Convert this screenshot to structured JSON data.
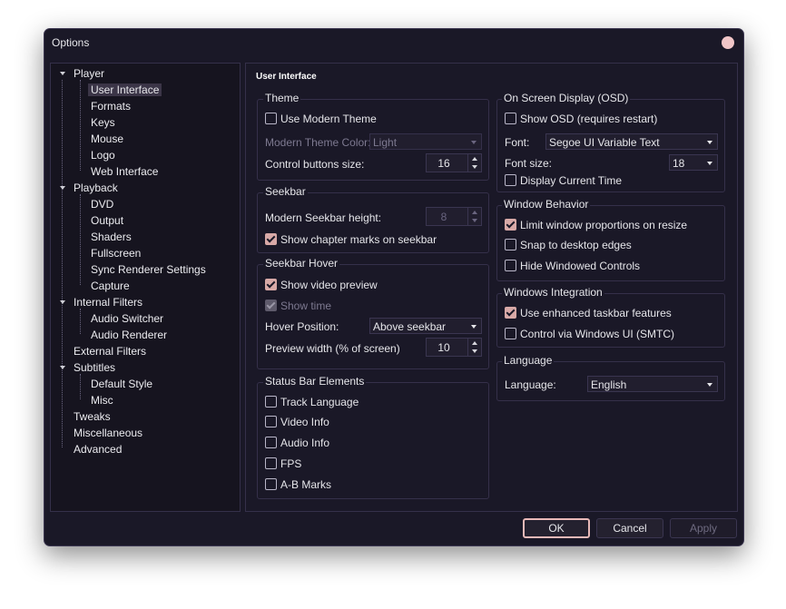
{
  "window": {
    "title": "Options"
  },
  "tree": {
    "items": [
      {
        "label": "Player",
        "level": 0,
        "expanded": true
      },
      {
        "label": "User Interface",
        "level": 1,
        "selected": true
      },
      {
        "label": "Formats",
        "level": 1
      },
      {
        "label": "Keys",
        "level": 1
      },
      {
        "label": "Mouse",
        "level": 1
      },
      {
        "label": "Logo",
        "level": 1
      },
      {
        "label": "Web Interface",
        "level": 1
      },
      {
        "label": "Playback",
        "level": 0,
        "expanded": true
      },
      {
        "label": "DVD",
        "level": 1
      },
      {
        "label": "Output",
        "level": 1
      },
      {
        "label": "Shaders",
        "level": 1
      },
      {
        "label": "Fullscreen",
        "level": 1
      },
      {
        "label": "Sync Renderer Settings",
        "level": 1
      },
      {
        "label": "Capture",
        "level": 1
      },
      {
        "label": "Internal Filters",
        "level": 0,
        "expanded": true
      },
      {
        "label": "Audio Switcher",
        "level": 1
      },
      {
        "label": "Audio Renderer",
        "level": 1
      },
      {
        "label": "External Filters",
        "level": 0
      },
      {
        "label": "Subtitles",
        "level": 0,
        "expanded": true
      },
      {
        "label": "Default Style",
        "level": 1
      },
      {
        "label": "Misc",
        "level": 1
      },
      {
        "label": "Tweaks",
        "level": 0
      },
      {
        "label": "Miscellaneous",
        "level": 0
      },
      {
        "label": "Advanced",
        "level": 0
      }
    ]
  },
  "page": {
    "title": "User Interface",
    "theme": {
      "title": "Theme",
      "use_modern_theme": "Use Modern Theme",
      "color_label": "Modern Theme Color:",
      "color_value": "Light",
      "buttons_size_label": "Control buttons size:",
      "buttons_size_value": "16"
    },
    "seekbar": {
      "title": "Seekbar",
      "height_label": "Modern Seekbar height:",
      "height_value": "8",
      "chapter_marks": "Show chapter marks on seekbar"
    },
    "seekbar_hover": {
      "title": "Seekbar Hover",
      "video_preview": "Show video preview",
      "show_time": "Show time",
      "position_label": "Hover Position:",
      "position_value": "Above seekbar",
      "preview_width_label": "Preview width (% of screen)",
      "preview_width_value": "10"
    },
    "status_bar": {
      "title": "Status Bar Elements",
      "items": [
        "Track Language",
        "Video Info",
        "Audio Info",
        "FPS",
        "A-B Marks"
      ]
    },
    "osd": {
      "title": "On Screen Display (OSD)",
      "show_osd": "Show OSD (requires restart)",
      "font_label": "Font:",
      "font_value": "Segoe UI Variable Text",
      "font_size_label": "Font size:",
      "font_size_value": "18",
      "display_time": "Display Current Time"
    },
    "window_behavior": {
      "title": "Window Behavior",
      "limit_proportions": "Limit window proportions on resize",
      "snap_edges": "Snap to desktop edges",
      "hide_controls": "Hide Windowed Controls"
    },
    "windows_integration": {
      "title": "Windows Integration",
      "taskbar": "Use enhanced taskbar features",
      "smtc": "Control via Windows UI (SMTC)"
    },
    "language": {
      "title": "Language",
      "label": "Language:",
      "value": "English"
    }
  },
  "buttons": {
    "ok": "OK",
    "cancel": "Cancel",
    "apply": "Apply"
  },
  "colors": {
    "accent": "#d8a9a7",
    "background": "#1a1827",
    "border": "#35304a"
  }
}
